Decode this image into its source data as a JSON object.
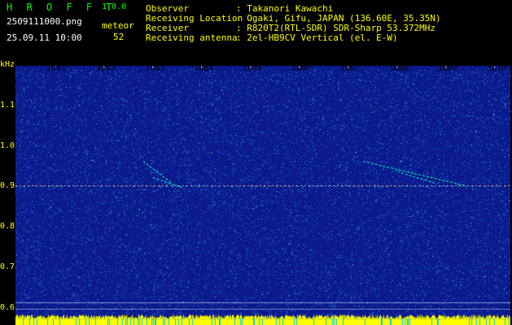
{
  "app": {
    "title": "H R O F F T",
    "version": "1.0.0",
    "filename": "2509111000.png",
    "datetime": "25.09.11 10:00",
    "meteor_label": "meteor",
    "meteor_count": "52"
  },
  "info": {
    "labels": [
      "Observer",
      "Receiving Location",
      "Receiver",
      "Receiving antenna"
    ],
    "values": [
      ": Takanori Kawachi",
      ": Ogaki, Gifu, JAPAN (136.60E, 35.35N)",
      ": R820T2(RTL-SDR) SDR-Sharp 53.372MHz",
      ": 2el-HB9CV Vertical (el. E-W)"
    ]
  },
  "chart_data": {
    "type": "heatmap",
    "ylabel": "kHz",
    "y_ticks": [
      "1.1",
      "1.0",
      "0.9",
      "0.8",
      "0.7",
      "0.6"
    ],
    "ylim": [
      0.56,
      1.16
    ],
    "x_ticks": [
      "1001",
      "1002",
      "1003",
      "1004",
      "1005",
      "1006",
      "1007",
      "1008",
      "1009",
      "1010"
    ],
    "xlim": [
      1000.5,
      1010.5
    ],
    "carrier_khz": 0.9,
    "meteor_echoes": [
      {
        "t": [
          1002.8,
          1003.4
        ],
        "f": [
          0.96,
          0.905
        ]
      },
      {
        "t": [
          1003.0,
          1003.6
        ],
        "f": [
          0.92,
          0.895
        ]
      },
      {
        "t": [
          1007.3,
          1009.4
        ],
        "f": [
          0.96,
          0.9
        ]
      },
      {
        "t": [
          1008.0,
          1008.8
        ],
        "f": [
          0.935,
          0.905
        ]
      }
    ],
    "colors": {
      "background": "#0a1a8c",
      "noise": "#1f5fd8",
      "signal": "#00ffc0",
      "grid": "#ffffff",
      "baseline": "#ffff00",
      "baseline_gap": "#00c8ff"
    }
  }
}
